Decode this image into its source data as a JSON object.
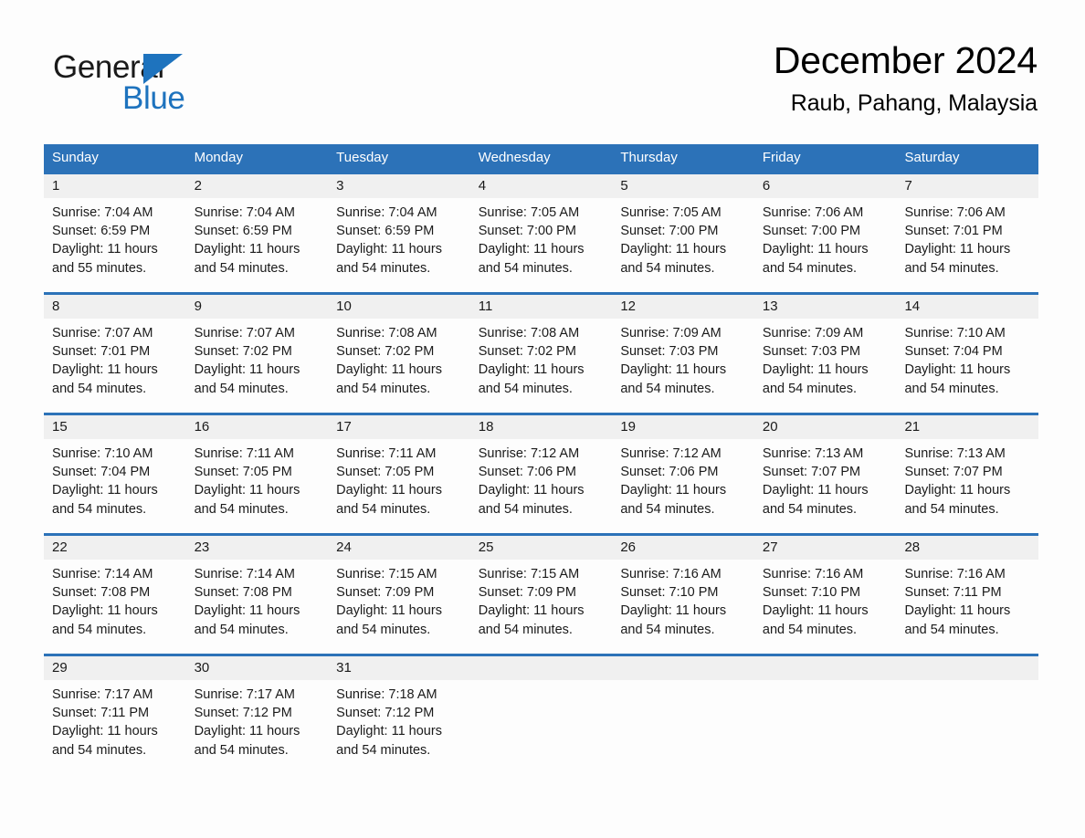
{
  "logo": {
    "word_one": "General",
    "word_two": "Blue",
    "triangle_icon": "triangle-icon"
  },
  "header": {
    "title": "December 2024",
    "location": "Raub, Pahang, Malaysia"
  },
  "colors": {
    "header_blue": "#2c72b8",
    "day_strip_gray": "#f0f0f0",
    "logo_blue": "#1e73be",
    "page_background": "#fdfdfd"
  },
  "weekdays": [
    "Sunday",
    "Monday",
    "Tuesday",
    "Wednesday",
    "Thursday",
    "Friday",
    "Saturday"
  ],
  "weeks": [
    [
      {
        "day": "1",
        "sunrise": "Sunrise: 7:04 AM",
        "sunset": "Sunset: 6:59 PM",
        "daylight_line1": "Daylight: 11 hours",
        "daylight_line2": "and 55 minutes."
      },
      {
        "day": "2",
        "sunrise": "Sunrise: 7:04 AM",
        "sunset": "Sunset: 6:59 PM",
        "daylight_line1": "Daylight: 11 hours",
        "daylight_line2": "and 54 minutes."
      },
      {
        "day": "3",
        "sunrise": "Sunrise: 7:04 AM",
        "sunset": "Sunset: 6:59 PM",
        "daylight_line1": "Daylight: 11 hours",
        "daylight_line2": "and 54 minutes."
      },
      {
        "day": "4",
        "sunrise": "Sunrise: 7:05 AM",
        "sunset": "Sunset: 7:00 PM",
        "daylight_line1": "Daylight: 11 hours",
        "daylight_line2": "and 54 minutes."
      },
      {
        "day": "5",
        "sunrise": "Sunrise: 7:05 AM",
        "sunset": "Sunset: 7:00 PM",
        "daylight_line1": "Daylight: 11 hours",
        "daylight_line2": "and 54 minutes."
      },
      {
        "day": "6",
        "sunrise": "Sunrise: 7:06 AM",
        "sunset": "Sunset: 7:00 PM",
        "daylight_line1": "Daylight: 11 hours",
        "daylight_line2": "and 54 minutes."
      },
      {
        "day": "7",
        "sunrise": "Sunrise: 7:06 AM",
        "sunset": "Sunset: 7:01 PM",
        "daylight_line1": "Daylight: 11 hours",
        "daylight_line2": "and 54 minutes."
      }
    ],
    [
      {
        "day": "8",
        "sunrise": "Sunrise: 7:07 AM",
        "sunset": "Sunset: 7:01 PM",
        "daylight_line1": "Daylight: 11 hours",
        "daylight_line2": "and 54 minutes."
      },
      {
        "day": "9",
        "sunrise": "Sunrise: 7:07 AM",
        "sunset": "Sunset: 7:02 PM",
        "daylight_line1": "Daylight: 11 hours",
        "daylight_line2": "and 54 minutes."
      },
      {
        "day": "10",
        "sunrise": "Sunrise: 7:08 AM",
        "sunset": "Sunset: 7:02 PM",
        "daylight_line1": "Daylight: 11 hours",
        "daylight_line2": "and 54 minutes."
      },
      {
        "day": "11",
        "sunrise": "Sunrise: 7:08 AM",
        "sunset": "Sunset: 7:02 PM",
        "daylight_line1": "Daylight: 11 hours",
        "daylight_line2": "and 54 minutes."
      },
      {
        "day": "12",
        "sunrise": "Sunrise: 7:09 AM",
        "sunset": "Sunset: 7:03 PM",
        "daylight_line1": "Daylight: 11 hours",
        "daylight_line2": "and 54 minutes."
      },
      {
        "day": "13",
        "sunrise": "Sunrise: 7:09 AM",
        "sunset": "Sunset: 7:03 PM",
        "daylight_line1": "Daylight: 11 hours",
        "daylight_line2": "and 54 minutes."
      },
      {
        "day": "14",
        "sunrise": "Sunrise: 7:10 AM",
        "sunset": "Sunset: 7:04 PM",
        "daylight_line1": "Daylight: 11 hours",
        "daylight_line2": "and 54 minutes."
      }
    ],
    [
      {
        "day": "15",
        "sunrise": "Sunrise: 7:10 AM",
        "sunset": "Sunset: 7:04 PM",
        "daylight_line1": "Daylight: 11 hours",
        "daylight_line2": "and 54 minutes."
      },
      {
        "day": "16",
        "sunrise": "Sunrise: 7:11 AM",
        "sunset": "Sunset: 7:05 PM",
        "daylight_line1": "Daylight: 11 hours",
        "daylight_line2": "and 54 minutes."
      },
      {
        "day": "17",
        "sunrise": "Sunrise: 7:11 AM",
        "sunset": "Sunset: 7:05 PM",
        "daylight_line1": "Daylight: 11 hours",
        "daylight_line2": "and 54 minutes."
      },
      {
        "day": "18",
        "sunrise": "Sunrise: 7:12 AM",
        "sunset": "Sunset: 7:06 PM",
        "daylight_line1": "Daylight: 11 hours",
        "daylight_line2": "and 54 minutes."
      },
      {
        "day": "19",
        "sunrise": "Sunrise: 7:12 AM",
        "sunset": "Sunset: 7:06 PM",
        "daylight_line1": "Daylight: 11 hours",
        "daylight_line2": "and 54 minutes."
      },
      {
        "day": "20",
        "sunrise": "Sunrise: 7:13 AM",
        "sunset": "Sunset: 7:07 PM",
        "daylight_line1": "Daylight: 11 hours",
        "daylight_line2": "and 54 minutes."
      },
      {
        "day": "21",
        "sunrise": "Sunrise: 7:13 AM",
        "sunset": "Sunset: 7:07 PM",
        "daylight_line1": "Daylight: 11 hours",
        "daylight_line2": "and 54 minutes."
      }
    ],
    [
      {
        "day": "22",
        "sunrise": "Sunrise: 7:14 AM",
        "sunset": "Sunset: 7:08 PM",
        "daylight_line1": "Daylight: 11 hours",
        "daylight_line2": "and 54 minutes."
      },
      {
        "day": "23",
        "sunrise": "Sunrise: 7:14 AM",
        "sunset": "Sunset: 7:08 PM",
        "daylight_line1": "Daylight: 11 hours",
        "daylight_line2": "and 54 minutes."
      },
      {
        "day": "24",
        "sunrise": "Sunrise: 7:15 AM",
        "sunset": "Sunset: 7:09 PM",
        "daylight_line1": "Daylight: 11 hours",
        "daylight_line2": "and 54 minutes."
      },
      {
        "day": "25",
        "sunrise": "Sunrise: 7:15 AM",
        "sunset": "Sunset: 7:09 PM",
        "daylight_line1": "Daylight: 11 hours",
        "daylight_line2": "and 54 minutes."
      },
      {
        "day": "26",
        "sunrise": "Sunrise: 7:16 AM",
        "sunset": "Sunset: 7:10 PM",
        "daylight_line1": "Daylight: 11 hours",
        "daylight_line2": "and 54 minutes."
      },
      {
        "day": "27",
        "sunrise": "Sunrise: 7:16 AM",
        "sunset": "Sunset: 7:10 PM",
        "daylight_line1": "Daylight: 11 hours",
        "daylight_line2": "and 54 minutes."
      },
      {
        "day": "28",
        "sunrise": "Sunrise: 7:16 AM",
        "sunset": "Sunset: 7:11 PM",
        "daylight_line1": "Daylight: 11 hours",
        "daylight_line2": "and 54 minutes."
      }
    ],
    [
      {
        "day": "29",
        "sunrise": "Sunrise: 7:17 AM",
        "sunset": "Sunset: 7:11 PM",
        "daylight_line1": "Daylight: 11 hours",
        "daylight_line2": "and 54 minutes."
      },
      {
        "day": "30",
        "sunrise": "Sunrise: 7:17 AM",
        "sunset": "Sunset: 7:12 PM",
        "daylight_line1": "Daylight: 11 hours",
        "daylight_line2": "and 54 minutes."
      },
      {
        "day": "31",
        "sunrise": "Sunrise: 7:18 AM",
        "sunset": "Sunset: 7:12 PM",
        "daylight_line1": "Daylight: 11 hours",
        "daylight_line2": "and 54 minutes."
      },
      {
        "day": "",
        "sunrise": "",
        "sunset": "",
        "daylight_line1": "",
        "daylight_line2": ""
      },
      {
        "day": "",
        "sunrise": "",
        "sunset": "",
        "daylight_line1": "",
        "daylight_line2": ""
      },
      {
        "day": "",
        "sunrise": "",
        "sunset": "",
        "daylight_line1": "",
        "daylight_line2": ""
      },
      {
        "day": "",
        "sunrise": "",
        "sunset": "",
        "daylight_line1": "",
        "daylight_line2": ""
      }
    ]
  ]
}
